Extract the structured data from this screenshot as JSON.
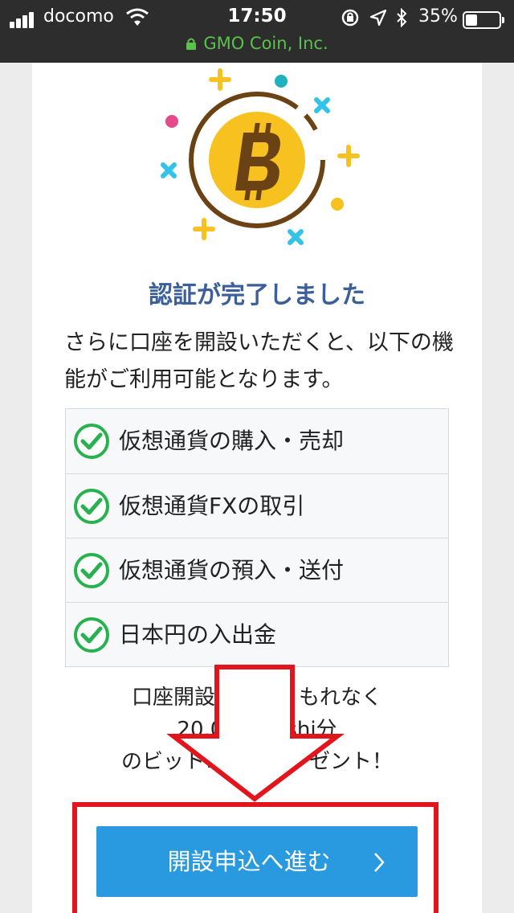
{
  "status_bar": {
    "carrier": "docomo",
    "time": "17:50",
    "battery_percent": "35%",
    "battery_level": 0.35,
    "site": "GMO Coin, Inc.",
    "icons": [
      "signal-icon",
      "wifi-icon",
      "rotation-lock-icon",
      "location-arrow-icon",
      "bluetooth-icon",
      "battery-icon",
      "lock-icon"
    ]
  },
  "hero": {
    "icon": "bitcoin-icon",
    "colors": {
      "coin": "#f7c21f",
      "ring": "#6b4214",
      "yellow_plus": "#f7c21f",
      "blue_cross": "#33c3e8",
      "pink_dot": "#e54a8a",
      "teal_dot": "#1fb1c0"
    }
  },
  "title": "認証が完了しました",
  "description": "さらに口座を開設いただくと、以下の機能がご利用可能となります。",
  "features": [
    {
      "label": "仮想通貨の購入・売却",
      "icon": "check-circle-icon"
    },
    {
      "label": "仮想通貨FXの取引",
      "icon": "check-circle-icon"
    },
    {
      "label": "仮想通貨の預入・送付",
      "icon": "check-circle-icon"
    },
    {
      "label": "日本円の入出金",
      "icon": "check-circle-icon"
    }
  ],
  "promo": {
    "line1": "口座開設　　　　もれなく",
    "line2": "20,0　　　shi分",
    "line3": "のビットコ　　プレゼント！"
  },
  "cta": {
    "label": "開設申込へ進む",
    "icon": "chevron-right-icon",
    "color": "#2a9ae0"
  },
  "annotation": {
    "color": "#e2141c"
  }
}
